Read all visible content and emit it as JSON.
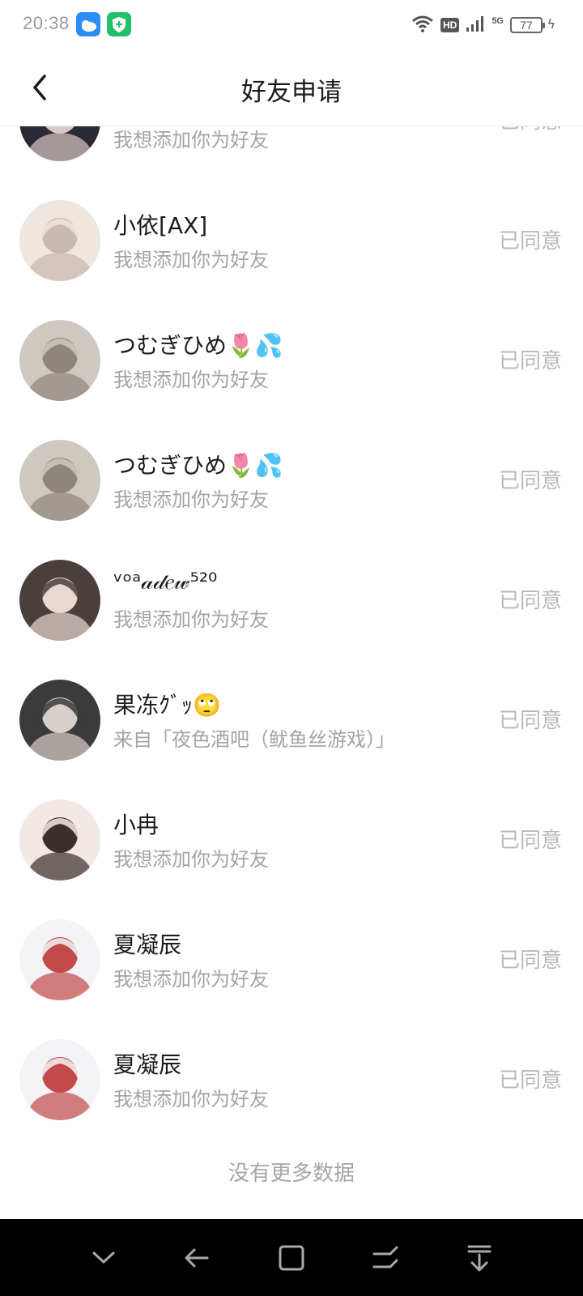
{
  "status_bar": {
    "time": "20:38",
    "hd_label": "HD",
    "network_label": "5G",
    "battery_level": "77"
  },
  "header": {
    "title": "好友申请",
    "back_icon": "chevron-left-icon"
  },
  "requests": [
    {
      "name": "",
      "message": "我想添加你为好友",
      "status": "已同意",
      "avatar_colors": [
        "#2a2a35",
        "#d9c8c8"
      ]
    },
    {
      "name": "小依[AX]",
      "message": "我想添加你为好友",
      "status": "已同意",
      "avatar_colors": [
        "#efe6df",
        "#c9b8ad"
      ]
    },
    {
      "name": "つむぎひめ🌷💦",
      "message": "我想添加你为好友",
      "status": "已同意",
      "avatar_colors": [
        "#cfc8c0",
        "#8e857c"
      ]
    },
    {
      "name": "つむぎひめ🌷💦",
      "message": "我想添加你为好友",
      "status": "已同意",
      "avatar_colors": [
        "#cfc8c0",
        "#8e857c"
      ]
    },
    {
      "name": "ᵛᵒᵃ𝒶𝒹𝑒𝓌⁵²⁰",
      "message": "我想添加你为好友",
      "status": "已同意",
      "avatar_colors": [
        "#4a3f3b",
        "#e8d8d2"
      ]
    },
    {
      "name": "果冻ｸﾞｯ🙄",
      "message": "来自「夜色酒吧（鱿鱼丝游戏）」",
      "status": "已同意",
      "avatar_colors": [
        "#3b3b3b",
        "#d8cfcb"
      ]
    },
    {
      "name": "小冉",
      "message": "我想添加你为好友",
      "status": "已同意",
      "avatar_colors": [
        "#f2e8e4",
        "#3a2f2c"
      ]
    },
    {
      "name": "夏凝辰",
      "message": "我想添加你为好友",
      "status": "已同意",
      "avatar_colors": [
        "#f4f4f6",
        "#c24a4a"
      ]
    },
    {
      "name": "夏凝辰",
      "message": "我想添加你为好友",
      "status": "已同意",
      "avatar_colors": [
        "#f4f4f6",
        "#c24a4a"
      ]
    }
  ],
  "footer": {
    "no_more_text": "没有更多数据"
  },
  "navbar": {
    "icons": [
      "chevron-down-icon",
      "back-arrow-icon",
      "recents-square-icon",
      "split-screen-icon",
      "download-stack-icon"
    ]
  }
}
